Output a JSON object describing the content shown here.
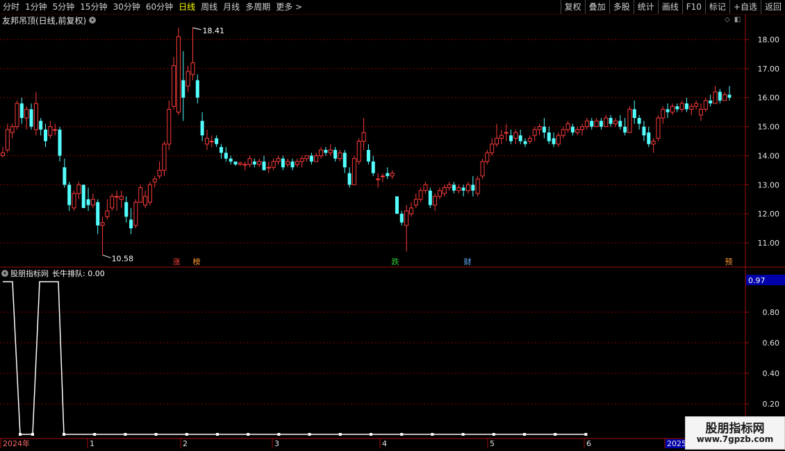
{
  "toolbar": {
    "periods": [
      "分时",
      "1分钟",
      "5分钟",
      "15分钟",
      "30分钟",
      "60分钟",
      "日线",
      "周线",
      "月线",
      "多周期",
      "更多 >"
    ],
    "active_period": "日线",
    "right_buttons": [
      "复权",
      "叠加",
      "多股",
      "统计",
      "画线",
      "F10",
      "标记",
      "+自选",
      "返回"
    ]
  },
  "main_panel": {
    "title": "友邦吊顶(日线,前复权)",
    "price_axis": [
      "18.00",
      "17.00",
      "16.00",
      "15.00",
      "14.00",
      "13.00",
      "12.00",
      "11.00"
    ],
    "high_label": "18.41",
    "low_label": "10.58",
    "event_markers": [
      {
        "text": "涨",
        "color": "#ff4040"
      },
      {
        "text": "榜",
        "color": "#ff9933"
      },
      {
        "text": "跌",
        "color": "#33cc33"
      },
      {
        "text": "财",
        "color": "#66b3ff"
      },
      {
        "text": "预",
        "color": "#ff9933"
      }
    ]
  },
  "sub_panel": {
    "name": "股朋指标网",
    "indicator": "长牛排队: 0.00",
    "value_badge": "0.97",
    "axis": [
      "0.80",
      "0.60",
      "0.40",
      "0.20"
    ]
  },
  "time_axis": {
    "labels": [
      "2024年",
      "1",
      "2",
      "3",
      "4",
      "5",
      "6",
      "2025"
    ]
  },
  "watermark": {
    "line1": "股朋指标网",
    "line2": "www.7gpzb.com"
  },
  "colors": {
    "up": "#ff3b3b",
    "down": "#54ffff",
    "grid": "#8b0000",
    "axis": "#a01010",
    "line": "#ffffff",
    "badge": "#0000aa"
  },
  "chart_data": {
    "type": "candlestick",
    "ylim": [
      10.4,
      18.7
    ],
    "candles": [
      [
        14.0,
        14.3,
        14.1,
        13.95
      ],
      [
        14.2,
        15.1,
        14.9,
        14.1
      ],
      [
        14.8,
        15.1,
        15.0,
        14.6
      ],
      [
        15.0,
        15.9,
        15.8,
        14.9
      ],
      [
        15.8,
        16.0,
        15.3,
        15.1
      ],
      [
        15.3,
        15.7,
        15.6,
        14.9
      ],
      [
        15.6,
        15.8,
        15.0,
        14.9
      ],
      [
        14.9,
        16.2,
        15.8,
        14.7
      ],
      [
        15.2,
        15.3,
        14.9,
        14.7
      ],
      [
        14.9,
        15.1,
        14.5,
        14.3
      ],
      [
        14.7,
        15.2,
        15.0,
        14.6
      ],
      [
        14.9,
        15.1,
        14.9,
        14.7
      ],
      [
        14.9,
        15.0,
        14.0,
        13.8
      ],
      [
        13.6,
        13.9,
        13.0,
        12.9
      ],
      [
        13.0,
        13.1,
        12.3,
        12.1
      ],
      [
        12.2,
        12.8,
        12.7,
        12.1
      ],
      [
        12.7,
        13.1,
        13.0,
        12.5
      ],
      [
        13.0,
        13.0,
        12.2,
        12.2
      ],
      [
        12.5,
        12.9,
        12.3,
        12.1
      ],
      [
        12.3,
        12.7,
        12.5,
        12.2
      ],
      [
        12.4,
        12.5,
        11.6,
        11.3
      ],
      [
        11.6,
        11.9,
        11.7,
        10.58
      ],
      [
        11.9,
        12.5,
        12.1,
        11.8
      ],
      [
        12.2,
        12.7,
        12.6,
        12.1
      ],
      [
        12.6,
        12.8,
        12.6,
        12.1
      ],
      [
        12.5,
        12.8,
        12.6,
        12.2
      ],
      [
        12.4,
        12.6,
        11.9,
        11.7
      ],
      [
        11.8,
        12.2,
        11.5,
        11.3
      ],
      [
        11.6,
        12.5,
        12.4,
        11.5
      ],
      [
        12.4,
        13.0,
        12.9,
        12.4
      ],
      [
        12.3,
        12.8,
        12.6,
        12.2
      ],
      [
        12.4,
        13.1,
        13.0,
        12.3
      ],
      [
        13.1,
        13.3,
        13.2,
        12.9
      ],
      [
        13.3,
        13.8,
        13.5,
        13.2
      ],
      [
        13.5,
        14.5,
        14.4,
        13.3
      ],
      [
        14.4,
        15.9,
        15.6,
        14.2
      ],
      [
        15.7,
        17.4,
        17.1,
        15.6
      ],
      [
        15.5,
        18.41,
        18.1,
        15.4
      ],
      [
        16.6,
        17.6,
        16.0,
        15.2
      ],
      [
        16.4,
        17.1,
        16.9,
        16.2
      ],
      [
        16.8,
        18.41,
        17.2,
        16.6
      ],
      [
        16.6,
        16.8,
        16.0,
        15.8
      ],
      [
        15.2,
        15.5,
        14.7,
        14.5
      ],
      [
        14.4,
        14.9,
        14.6,
        14.2
      ],
      [
        14.5,
        14.7,
        14.5,
        14.3
      ],
      [
        14.6,
        14.7,
        14.4,
        14.3
      ],
      [
        14.3,
        14.4,
        14.1,
        13.9
      ],
      [
        14.1,
        14.3,
        13.9,
        13.8
      ],
      [
        13.9,
        14.0,
        13.8,
        13.7
      ],
      [
        13.8,
        13.8,
        13.7,
        13.65
      ],
      [
        13.7,
        13.8,
        13.75,
        13.65
      ],
      [
        13.7,
        13.8,
        13.7,
        13.5
      ],
      [
        13.7,
        14.0,
        13.9,
        13.6
      ],
      [
        13.8,
        13.9,
        13.7,
        13.6
      ],
      [
        13.7,
        13.9,
        13.8,
        13.6
      ],
      [
        13.8,
        14.0,
        13.5,
        13.5
      ],
      [
        13.6,
        13.8,
        13.6,
        13.4
      ],
      [
        13.6,
        13.9,
        13.8,
        13.5
      ],
      [
        13.8,
        14.0,
        13.9,
        13.7
      ],
      [
        13.9,
        14.0,
        13.6,
        13.5
      ],
      [
        13.7,
        13.9,
        13.8,
        13.6
      ],
      [
        13.8,
        13.9,
        13.6,
        13.5
      ],
      [
        13.7,
        13.9,
        13.8,
        13.6
      ],
      [
        13.8,
        14.0,
        13.9,
        13.6
      ],
      [
        13.9,
        14.0,
        14.0,
        13.8
      ],
      [
        14.0,
        14.1,
        13.8,
        13.7
      ],
      [
        13.8,
        14.1,
        14.0,
        13.8
      ],
      [
        14.0,
        14.3,
        14.2,
        13.9
      ],
      [
        14.2,
        14.3,
        14.1,
        14.0
      ],
      [
        14.1,
        14.4,
        14.2,
        14.0
      ],
      [
        14.2,
        14.3,
        13.9,
        13.8
      ],
      [
        13.9,
        14.2,
        14.1,
        13.8
      ],
      [
        14.1,
        14.2,
        13.6,
        13.4
      ],
      [
        13.4,
        13.6,
        13.0,
        12.9
      ],
      [
        13.0,
        14.0,
        13.9,
        13.0
      ],
      [
        13.8,
        14.6,
        14.5,
        13.7
      ],
      [
        14.5,
        15.3,
        14.8,
        14.2
      ],
      [
        14.2,
        14.4,
        13.8,
        13.7
      ],
      [
        13.8,
        14.0,
        13.4,
        13.3
      ],
      [
        13.2,
        13.4,
        13.2,
        12.9
      ],
      [
        13.3,
        13.4,
        13.3,
        13.1
      ],
      [
        13.4,
        13.6,
        13.3,
        13.2
      ],
      [
        13.3,
        13.5,
        13.4,
        13.2
      ],
      [
        12.6,
        12.6,
        12.0,
        12.0
      ],
      [
        12.0,
        12.1,
        11.7,
        11.6
      ],
      [
        11.6,
        12.3,
        12.1,
        10.7
      ],
      [
        12.0,
        12.4,
        12.2,
        11.9
      ],
      [
        12.3,
        12.7,
        12.5,
        12.2
      ],
      [
        12.5,
        12.9,
        12.8,
        12.4
      ],
      [
        12.8,
        13.1,
        13.0,
        12.7
      ],
      [
        12.8,
        12.9,
        12.3,
        12.2
      ],
      [
        12.3,
        12.7,
        12.6,
        12.1
      ],
      [
        12.6,
        12.9,
        12.8,
        12.5
      ],
      [
        12.7,
        13.0,
        12.9,
        12.6
      ],
      [
        12.9,
        13.1,
        13.0,
        12.8
      ],
      [
        13.0,
        13.1,
        12.8,
        12.7
      ],
      [
        12.8,
        13.0,
        12.9,
        12.7
      ],
      [
        12.9,
        13.0,
        12.8,
        12.6
      ],
      [
        12.8,
        13.1,
        13.0,
        12.7
      ],
      [
        13.0,
        13.3,
        12.8,
        12.6
      ],
      [
        12.7,
        13.3,
        13.2,
        12.6
      ],
      [
        13.3,
        13.9,
        13.8,
        13.2
      ],
      [
        13.8,
        14.2,
        14.1,
        13.7
      ],
      [
        14.1,
        14.6,
        14.4,
        14.0
      ],
      [
        14.4,
        15.1,
        14.6,
        14.3
      ],
      [
        14.6,
        14.9,
        14.7,
        14.4
      ],
      [
        14.8,
        15.1,
        14.8,
        14.5
      ],
      [
        14.7,
        14.9,
        14.5,
        14.4
      ],
      [
        14.6,
        14.9,
        14.8,
        14.4
      ],
      [
        14.7,
        14.9,
        14.5,
        14.4
      ],
      [
        14.5,
        14.6,
        14.4,
        14.3
      ],
      [
        14.5,
        14.7,
        14.6,
        14.4
      ],
      [
        14.7,
        15.0,
        14.9,
        14.5
      ],
      [
        14.9,
        15.1,
        15.0,
        14.7
      ],
      [
        15.0,
        15.3,
        14.8,
        14.6
      ],
      [
        14.8,
        15.0,
        14.5,
        14.4
      ],
      [
        14.6,
        14.8,
        14.4,
        14.3
      ],
      [
        14.4,
        14.8,
        14.7,
        14.3
      ],
      [
        14.7,
        15.0,
        14.9,
        14.6
      ],
      [
        14.9,
        15.2,
        15.1,
        14.8
      ],
      [
        15.0,
        15.1,
        14.8,
        14.7
      ],
      [
        14.8,
        15.0,
        14.9,
        14.7
      ],
      [
        14.9,
        15.1,
        15.0,
        14.7
      ],
      [
        15.0,
        15.3,
        15.2,
        14.9
      ],
      [
        15.2,
        15.3,
        15.0,
        14.9
      ],
      [
        15.0,
        15.3,
        15.2,
        15.0
      ],
      [
        15.2,
        15.3,
        15.0,
        14.9
      ],
      [
        15.0,
        15.4,
        15.3,
        15.0
      ],
      [
        15.3,
        15.4,
        15.1,
        15.0
      ],
      [
        15.1,
        15.3,
        15.2,
        15.0
      ],
      [
        15.2,
        15.4,
        15.0,
        14.9
      ],
      [
        15.0,
        15.3,
        14.8,
        14.7
      ],
      [
        14.8,
        15.7,
        15.6,
        14.8
      ],
      [
        15.6,
        15.9,
        15.3,
        15.1
      ],
      [
        15.3,
        15.4,
        15.1,
        14.9
      ],
      [
        15.0,
        15.2,
        14.7,
        14.5
      ],
      [
        14.8,
        15.0,
        14.4,
        14.3
      ],
      [
        14.4,
        14.6,
        14.5,
        14.1
      ],
      [
        14.6,
        15.4,
        15.3,
        14.5
      ],
      [
        15.3,
        15.7,
        15.6,
        15.1
      ],
      [
        15.6,
        15.8,
        15.5,
        15.3
      ],
      [
        15.5,
        15.8,
        15.7,
        15.4
      ],
      [
        15.7,
        15.8,
        15.6,
        15.5
      ],
      [
        15.6,
        15.9,
        15.8,
        15.5
      ],
      [
        15.8,
        16.0,
        15.6,
        15.5
      ],
      [
        15.6,
        15.8,
        15.7,
        15.4
      ],
      [
        15.7,
        15.9,
        15.8,
        15.6
      ],
      [
        15.4,
        15.8,
        15.6,
        15.2
      ],
      [
        15.6,
        16.0,
        15.9,
        15.5
      ],
      [
        15.9,
        16.1,
        15.8,
        15.7
      ],
      [
        15.8,
        16.4,
        16.2,
        15.8
      ],
      [
        16.2,
        16.3,
        15.9,
        15.8
      ],
      [
        15.9,
        16.2,
        16.1,
        15.9
      ],
      [
        16.1,
        16.4,
        16.0,
        15.9
      ]
    ],
    "indicator_series": [
      1,
      1,
      0,
      0,
      1,
      1,
      0,
      0,
      0,
      0,
      0,
      0,
      0,
      0,
      0,
      0,
      0,
      0,
      0,
      0,
      0,
      0,
      0,
      0
    ]
  }
}
